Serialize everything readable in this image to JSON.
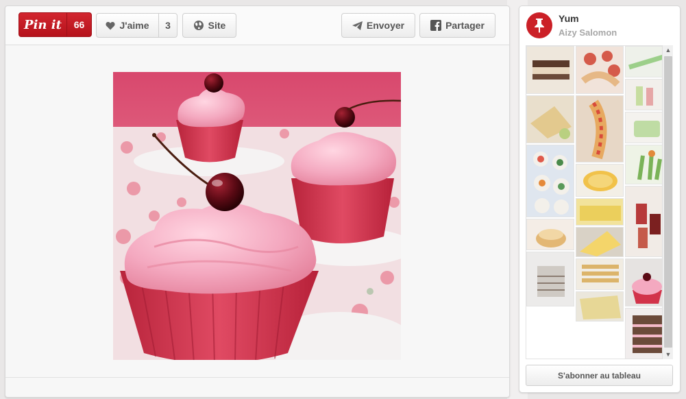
{
  "toolbar": {
    "pin_label": "Pin it",
    "pin_count": "66",
    "like_label": "J'aime",
    "like_count": "3",
    "site_label": "Site",
    "send_label": "Envoyer",
    "share_label": "Partager"
  },
  "board": {
    "title": "Yum",
    "owner": "Aizy Salomon",
    "subscribe_label": "S'abonner au tableau"
  },
  "colors": {
    "pinterest_red": "#cb2027",
    "cupcake_pink": "#f4a9c0",
    "liner_red": "#d8374f"
  },
  "icons": {
    "like": "heart-icon",
    "site": "globe-icon",
    "send": "paper-plane-icon",
    "share": "facebook-icon",
    "board": "pushpin-icon"
  }
}
